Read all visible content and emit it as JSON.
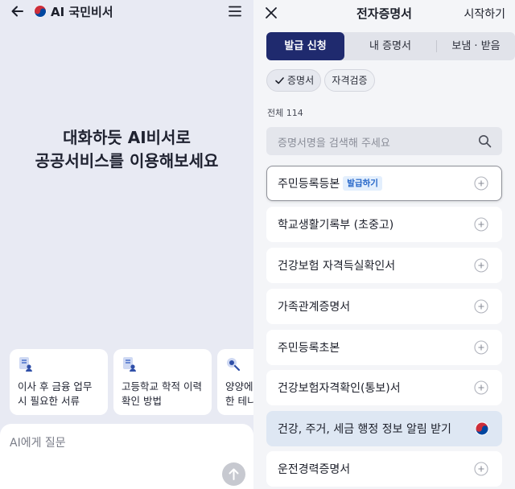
{
  "left": {
    "brand_title": "AI 국민비서",
    "headline": [
      "대화하듯 AI비서로",
      "공공서비스를 이용해보세요"
    ],
    "cards": [
      {
        "icon": "document-person-icon",
        "lines": [
          "이사 후 금융 업무",
          "시 필요한 서류"
        ]
      },
      {
        "icon": "document-person-icon",
        "lines": [
          "고등학교 학적 이력",
          "확인 방법"
        ]
      },
      {
        "icon": "magnifier-person-icon",
        "lines": [
          "양양에",
          "한 테니"
        ]
      }
    ],
    "ask_placeholder": "AI에게 질문"
  },
  "right": {
    "title": "전자증명서",
    "start_label": "시작하기",
    "tabs": [
      {
        "label": "발급 신청",
        "active": true
      },
      {
        "label": "내 증명서",
        "active": false
      },
      {
        "label": "보냄 · 받음",
        "active": false
      }
    ],
    "chips": [
      {
        "label": "증명서",
        "selected": true
      },
      {
        "label": "자격검증",
        "selected": false
      }
    ],
    "total_label": "전체 114",
    "search_placeholder": "증명서명을 검색해 주세요",
    "badge_label": "발급하기",
    "items": [
      {
        "label": "주민등록등본",
        "badge": true,
        "icon": "plus-circle-icon"
      },
      {
        "label": "학교생활기록부 (초중고)",
        "icon": "plus-circle-icon"
      },
      {
        "label": "건강보험 자격득실확인서",
        "icon": "plus-circle-icon"
      },
      {
        "label": "가족관계증명서",
        "icon": "plus-circle-icon"
      },
      {
        "label": "주민등록초본",
        "icon": "plus-circle-icon"
      },
      {
        "label": "건강보험자격확인(통보)서",
        "icon": "plus-circle-icon"
      },
      {
        "label": "건강, 주거, 세금 행정 정보 알림 받기",
        "icon": "korea-gov-icon"
      },
      {
        "label": "운전경력증명서",
        "icon": "plus-circle-icon"
      }
    ]
  },
  "colors": {
    "primary_navy": "#1f2a6e",
    "left_bg": "#e8eaf3",
    "badge_blue": "#2264c8",
    "banner_row": "#dee7f3"
  }
}
